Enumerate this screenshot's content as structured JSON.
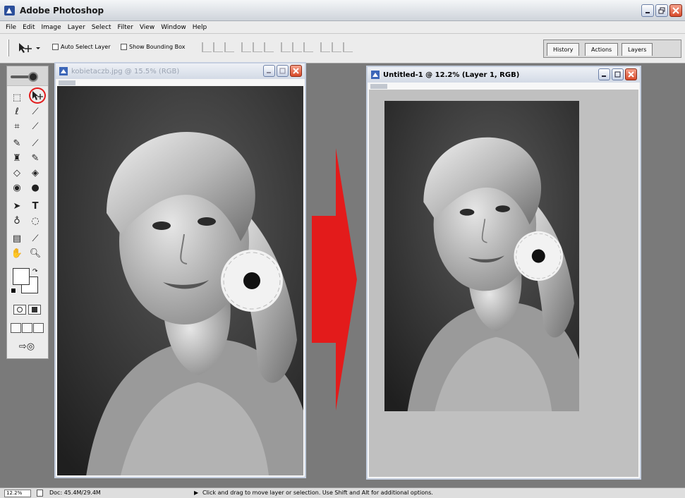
{
  "app": {
    "title": "Adobe Photoshop",
    "icon": "photoshop-app-icon"
  },
  "menu": [
    "File",
    "Edit",
    "Image",
    "Layer",
    "Select",
    "Filter",
    "View",
    "Window",
    "Help"
  ],
  "options": {
    "auto_select_label": "Auto Select Layer",
    "bounding_box_label": "Show Bounding Box"
  },
  "palette_tabs": [
    "History",
    "Actions",
    "Layers"
  ],
  "documents": {
    "source": {
      "title": "kobietaczb.jpg @ 15.5% (RGB)"
    },
    "target": {
      "title": "Untitled-1 @ 12.2% (Layer 1, RGB)"
    }
  },
  "status": {
    "zoom": "12.2%",
    "doc": "Doc: 45.4M/29.4M",
    "message": "Click and drag to move layer or selection.  Use Shift and Alt for additional options."
  },
  "colors": {
    "accent_red": "#e31b1b",
    "window_frame": "#c5cfe0"
  }
}
